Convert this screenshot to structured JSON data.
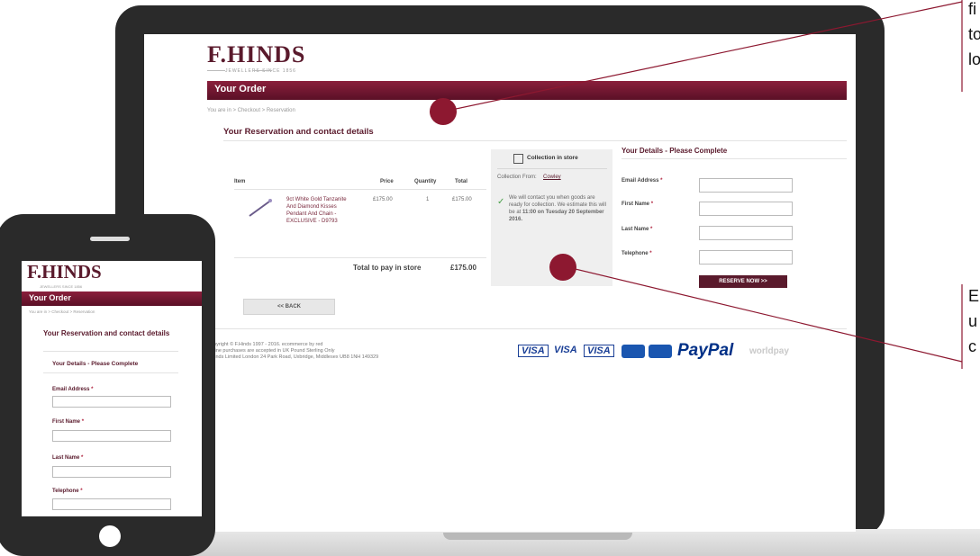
{
  "site": {
    "logo": "F.HINDS",
    "logo_sub": "JEWELLERS SINCE 1856",
    "order_bar": "Your Order",
    "breadcrumb": "You are in  >  Checkout  >  Reservation",
    "section_title": "Your Reservation and contact details"
  },
  "table": {
    "headers": [
      "Item",
      "Price",
      "Quantity",
      "Total"
    ],
    "row": {
      "description": "9ct White Gold Tanzanite And Diamond Kisses Pendant And Chain - EXCLUSIVE - D9793",
      "price": "£175.00",
      "quantity": "1",
      "total": "£175.00"
    },
    "total_label": "Total to pay in store",
    "total_value": "£175.00"
  },
  "collection": {
    "title": "Collection in store",
    "from_label": "Collection From:",
    "store": "Cowley",
    "message_plain": "We will contact you when goods are ready for collection. We estimate this will be at ",
    "message_bold": "11:00 on Tuesday 20 September 2016."
  },
  "details": {
    "title": "Your Details - Please Complete",
    "fields": [
      "Email Address",
      "First Name",
      "Last Name",
      "Telephone"
    ],
    "required_mark": "*",
    "reserve_button": "RESERVE NOW  >>",
    "back_button": "<< BACK"
  },
  "footer": {
    "line1": "Copyright © F.Hinds 1997 - 2016. ecommerce by red",
    "line2": "Online purchases are accepted in UK Pound Sterling Only",
    "line3": "F.Hinds Limited London 24 Park Road, Uxbridge, Middlesex UB8 1NH 149329",
    "payments": [
      "VISA",
      "VISA",
      "VISA",
      "PayPal",
      "worldpay"
    ]
  },
  "callouts": {
    "top": [
      "fi",
      "to",
      "lo"
    ],
    "bottom": [
      "E",
      "u",
      "c"
    ]
  },
  "mobile": {
    "logo": "F.HINDS",
    "logo_sub": "JEWELLERS SINCE 1856",
    "order_bar": "Your Order",
    "breadcrumb": "You are in  >  Checkout  >  Reservation",
    "section_title": "Your Reservation and contact details",
    "details_title": "Your Details - Please Complete",
    "fields": [
      "Email Address",
      "First Name",
      "Last Name",
      "Telephone"
    ]
  },
  "colors": {
    "brand": "#5a1a2c",
    "callout_dot": "#8d1830",
    "visa_blue": "#1a3f96",
    "paypal_blue": "#003087"
  }
}
